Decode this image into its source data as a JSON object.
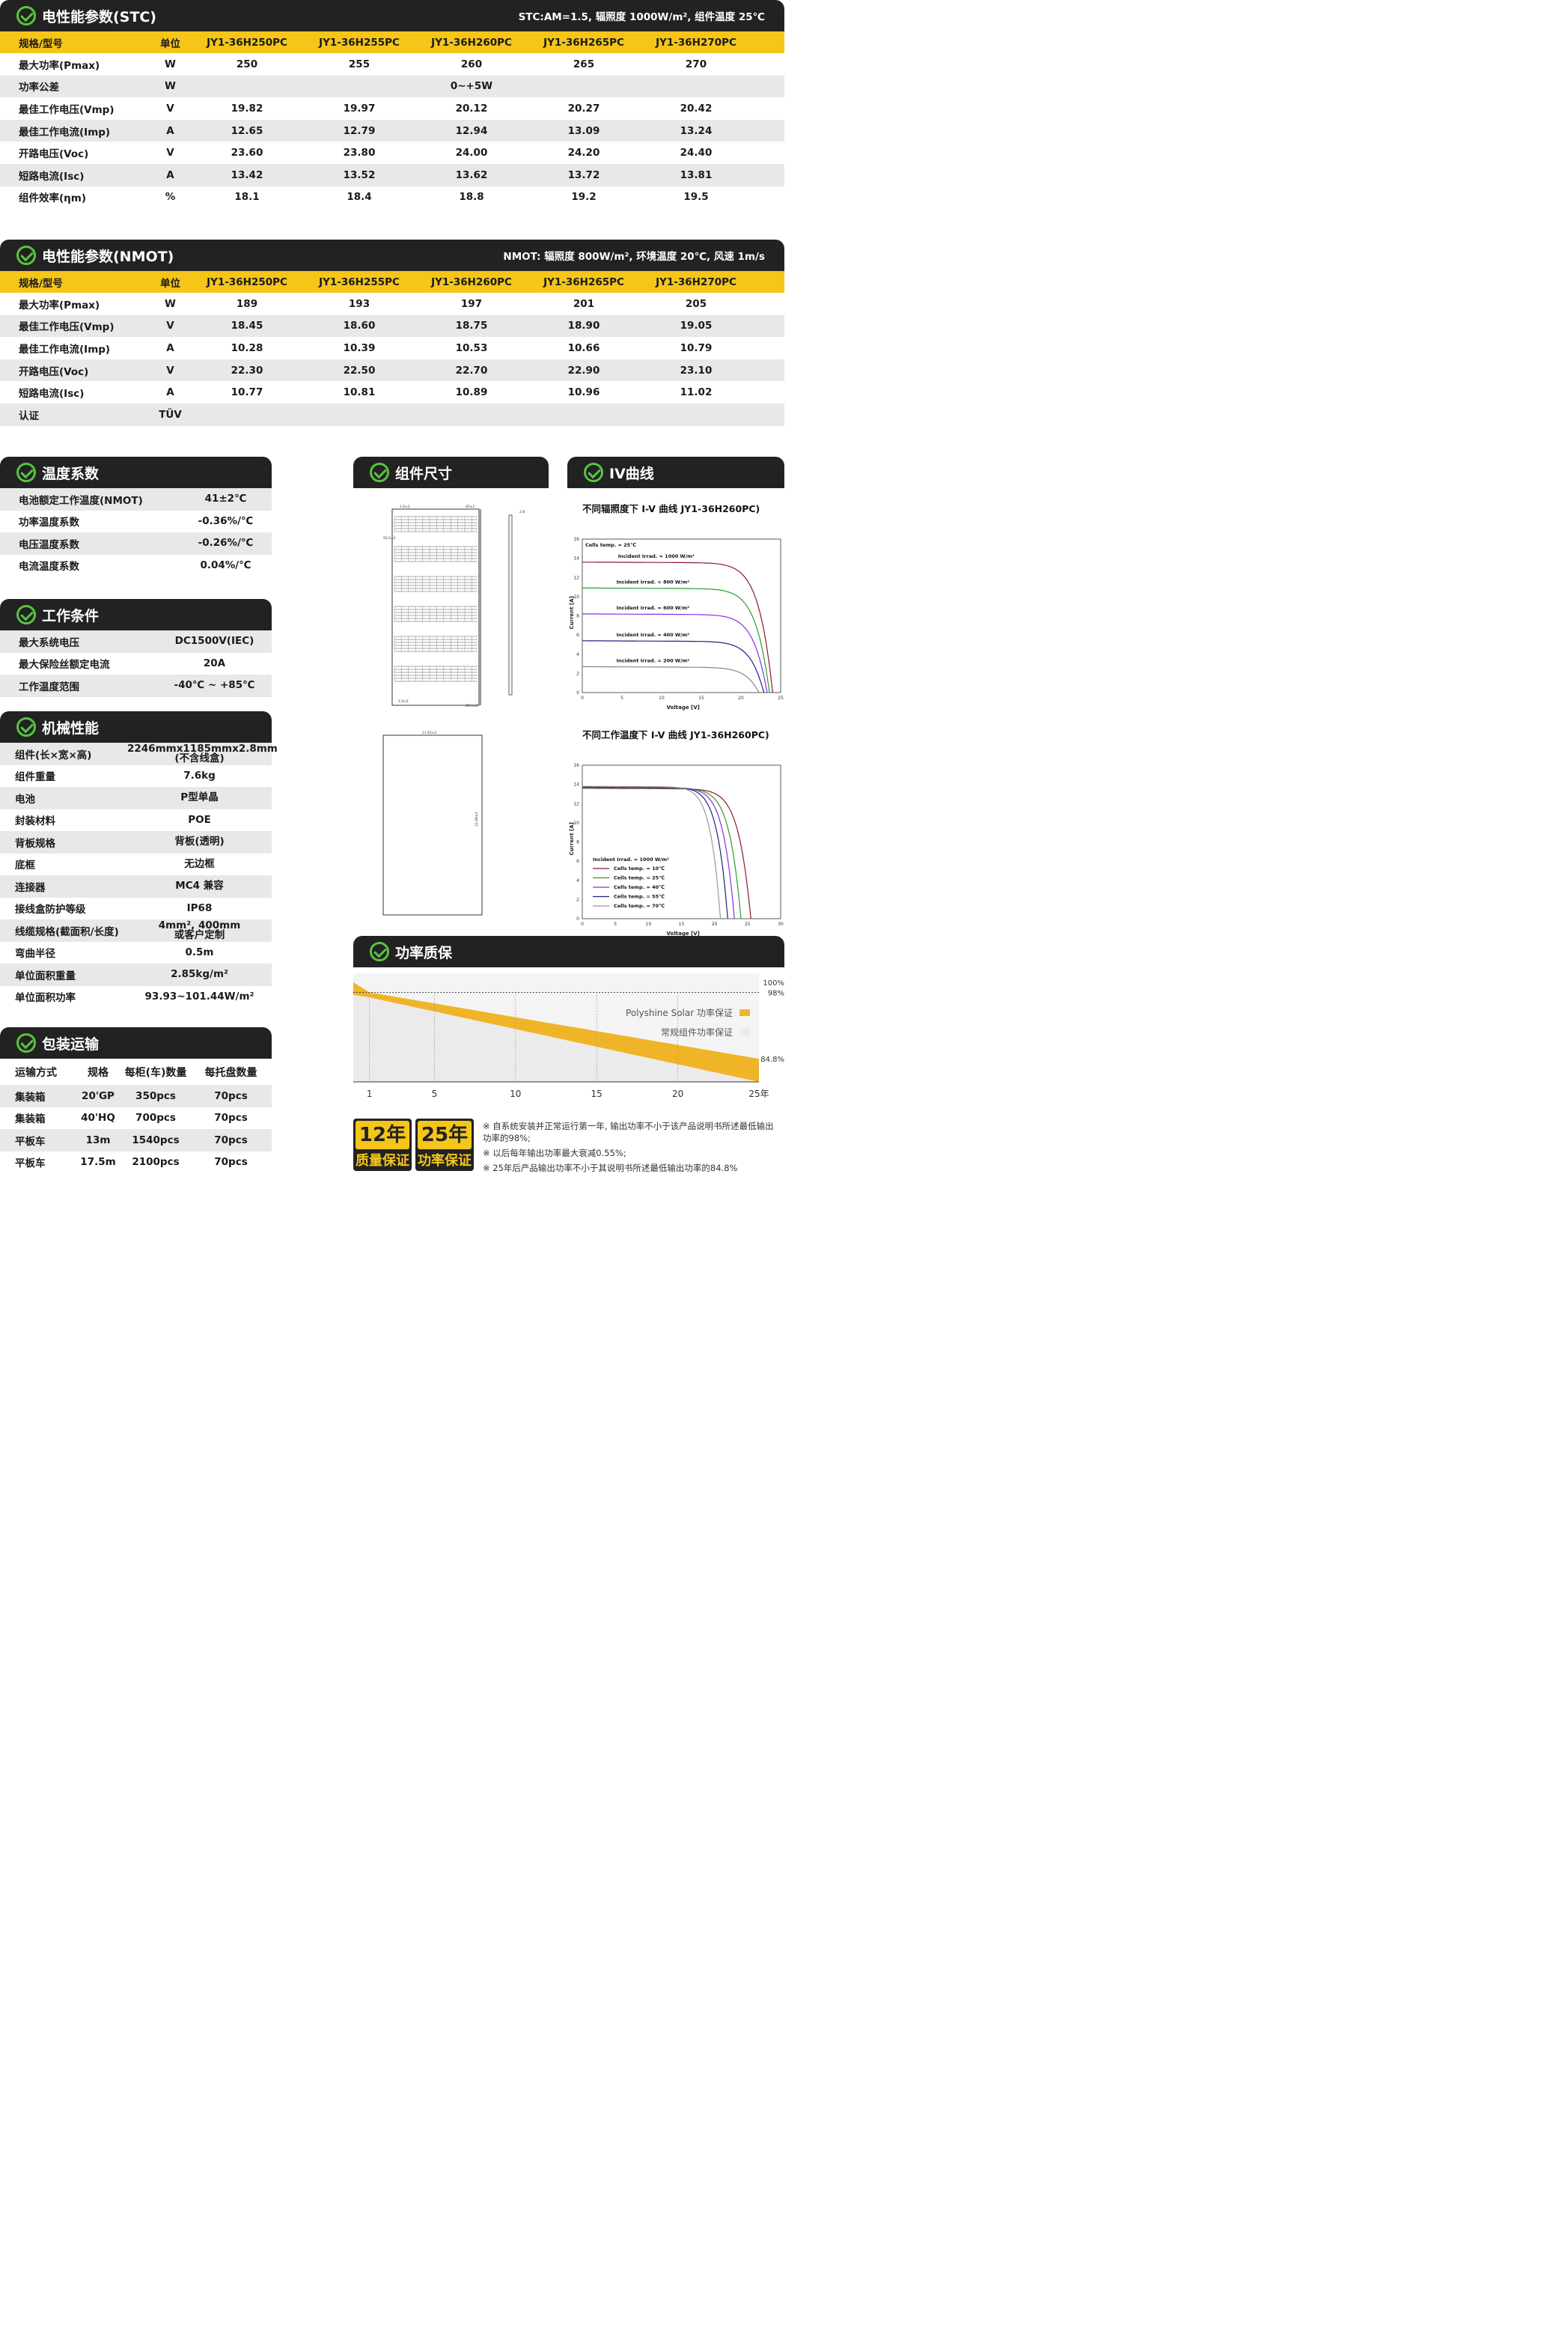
{
  "stc": {
    "title": "电性能参数(STC)",
    "note": "STC:AM=1.5, 辐照度 1000W/m², 组件温度 25℃",
    "header": [
      "规格/型号",
      "单位",
      "JY1-36H250PC",
      "JY1-36H255PC",
      "JY1-36H260PC",
      "JY1-36H265PC",
      "JY1-36H270PC"
    ],
    "rows": [
      [
        "最大功率(Pmax)",
        "W",
        "250",
        "255",
        "260",
        "265",
        "270"
      ],
      [
        "功率公差",
        "W",
        "",
        "",
        "0~+5W",
        "",
        ""
      ],
      [
        "最佳工作电压(Vmp)",
        "V",
        "19.82",
        "19.97",
        "20.12",
        "20.27",
        "20.42"
      ],
      [
        "最佳工作电流(Imp)",
        "A",
        "12.65",
        "12.79",
        "12.94",
        "13.09",
        "13.24"
      ],
      [
        "开路电压(Voc)",
        "V",
        "23.60",
        "23.80",
        "24.00",
        "24.20",
        "24.40"
      ],
      [
        "短路电流(Isc)",
        "A",
        "13.42",
        "13.52",
        "13.62",
        "13.72",
        "13.81"
      ],
      [
        "组件效率(ηm)",
        "%",
        "18.1",
        "18.4",
        "18.8",
        "19.2",
        "19.5"
      ]
    ]
  },
  "nmot": {
    "title": "电性能参数(NMOT)",
    "note": "NMOT: 辐照度 800W/m², 环境温度 20℃, 风速 1m/s",
    "header": [
      "规格/型号",
      "单位",
      "JY1-36H250PC",
      "JY1-36H255PC",
      "JY1-36H260PC",
      "JY1-36H265PC",
      "JY1-36H270PC"
    ],
    "rows": [
      [
        "最大功率(Pmax)",
        "W",
        "189",
        "193",
        "197",
        "201",
        "205"
      ],
      [
        "最佳工作电压(Vmp)",
        "V",
        "18.45",
        "18.60",
        "18.75",
        "18.90",
        "19.05"
      ],
      [
        "最佳工作电流(Imp)",
        "A",
        "10.28",
        "10.39",
        "10.53",
        "10.66",
        "10.79"
      ],
      [
        "开路电压(Voc)",
        "V",
        "22.30",
        "22.50",
        "22.70",
        "22.90",
        "23.10"
      ],
      [
        "短路电流(Isc)",
        "A",
        "10.77",
        "10.81",
        "10.89",
        "10.96",
        "11.02"
      ],
      [
        "认证",
        "TÜV",
        "",
        "",
        "",
        "",
        ""
      ]
    ]
  },
  "temp": {
    "title": "温度系数",
    "rows": [
      [
        "电池额定工作温度(NMOT)",
        "41±2℃"
      ],
      [
        "功率温度系数",
        "-0.36%/℃"
      ],
      [
        "电压温度系数",
        "-0.26%/℃"
      ],
      [
        "电流温度系数",
        "0.04%/℃"
      ]
    ]
  },
  "work": {
    "title": "工作条件",
    "rows": [
      [
        "最大系统电压",
        "DC1500V(IEC)"
      ],
      [
        "最大保险丝额定电流",
        "20A"
      ],
      [
        "工作温度范围",
        "-40℃ ~ +85℃"
      ]
    ]
  },
  "mech": {
    "title": "机械性能",
    "rows": [
      [
        "组件(长×宽×高)",
        "2246mmx1185mmx2.8mm\n(不含线盒)"
      ],
      [
        "组件重量",
        "7.6kg"
      ],
      [
        "电池",
        "P型单晶"
      ],
      [
        "封装材料",
        "POE"
      ],
      [
        "背板规格",
        "背板(透明)"
      ],
      [
        "底框",
        "无边框"
      ],
      [
        "连接器",
        "MC4 兼容"
      ],
      [
        "接线盒防护等级",
        "IP68"
      ],
      [
        "线缆规格(截面积/长度)",
        "4mm², 400mm\n或客户定制"
      ],
      [
        "弯曲半径",
        "0.5m"
      ],
      [
        "单位面积重量",
        "2.85kg/m²"
      ],
      [
        "单位面积功率",
        "93.93~101.44W/m²"
      ]
    ]
  },
  "pack": {
    "title": "包装运输",
    "header": [
      "运输方式",
      "规格",
      "每柜(车)数量",
      "每托盘数量"
    ],
    "rows": [
      [
        "集装箱",
        "20'GP",
        "350pcs",
        "70pcs"
      ],
      [
        "集装箱",
        "40'HQ",
        "700pcs",
        "70pcs"
      ],
      [
        "平板车",
        "13m",
        "1540pcs",
        "70pcs"
      ],
      [
        "平板车",
        "17.5m",
        "2100pcs",
        "70pcs"
      ]
    ]
  },
  "dim": {
    "title": "组件尺寸",
    "labels": [
      "1.6±2",
      "45±2",
      "2.8",
      "93.5±2",
      "1.6±2",
      "89.5±2",
      "11.65±2",
      "22.46±2"
    ]
  },
  "iv": {
    "title": "IV曲线"
  },
  "warranty": {
    "title": "功率质保",
    "badge1": {
      "years": "12年",
      "label": "质量保证"
    },
    "badge2": {
      "years": "25年",
      "label": "功率保证"
    },
    "notes": [
      "※ 自系统安装并正常运行第一年, 输出功率不小于该产品说明书所述最低输出功率的98%;",
      "※ 以后每年输出功率最大衰减0.55%;",
      "※ 25年后产品输出功率不小于其说明书所述最低输出功率的84.8%"
    ]
  },
  "chart_data": [
    {
      "type": "line",
      "title": "不同辐照度下 I-V 曲线  JY1-36H260PC)",
      "xlabel": "Voltage [V]",
      "ylabel": "Current [A]",
      "xlim": [
        0,
        25
      ],
      "ylim": [
        0,
        16
      ],
      "xticks": [
        "0",
        "5",
        "10",
        "15",
        "20",
        "25"
      ],
      "yticks": [
        "0",
        "2",
        "4",
        "6",
        "8",
        "10",
        "12",
        "14",
        "16"
      ],
      "annotation": "Cells temp. = 25℃",
      "series": [
        {
          "name": "Incident Irrad. = 1000 W/m²",
          "color": "#8b1a2b",
          "isc": 13.6,
          "voc": 24.0
        },
        {
          "name": "Incident Irrad. = 800 W/m²",
          "color": "#2a9d2a",
          "isc": 10.9,
          "voc": 23.6
        },
        {
          "name": "Incident Irrad. = 600 W/m²",
          "color": "#8a2be2",
          "isc": 8.2,
          "voc": 23.3
        },
        {
          "name": "Incident Irrad. = 400 W/m²",
          "color": "#1a237e",
          "isc": 5.4,
          "voc": 22.9
        },
        {
          "name": "Incident Irrad. = 200 W/m²",
          "color": "#888888",
          "isc": 2.7,
          "voc": 22.3
        }
      ]
    },
    {
      "type": "line",
      "title": "不同工作温度下 I-V 曲线  JY1-36H260PC)",
      "xlabel": "Voltage [V]",
      "ylabel": "Current [A]",
      "xlim": [
        0,
        30
      ],
      "ylim": [
        0,
        16
      ],
      "xticks": [
        "0",
        "5",
        "10",
        "15",
        "20",
        "25",
        "30"
      ],
      "yticks": [
        "0",
        "2",
        "4",
        "6",
        "8",
        "10",
        "12",
        "14",
        "16"
      ],
      "annotation": "Incident Irrad. = 1000 W/m²",
      "series": [
        {
          "name": "Cells temp. = 10℃",
          "color": "#8b1a2b",
          "isc": 13.6,
          "voc": 25.5
        },
        {
          "name": "Cells temp. = 25℃",
          "color": "#2a9d2a",
          "isc": 13.65,
          "voc": 24.0
        },
        {
          "name": "Cells temp. = 40℃",
          "color": "#8a2be2",
          "isc": 13.7,
          "voc": 23.0
        },
        {
          "name": "Cells temp. = 55℃",
          "color": "#1a237e",
          "isc": 13.75,
          "voc": 22.0
        },
        {
          "name": "Cells temp. = 70℃",
          "color": "#999999",
          "isc": 13.8,
          "voc": 20.9
        }
      ]
    },
    {
      "type": "area",
      "xlim": [
        0,
        25
      ],
      "ylim": [
        84.8,
        100
      ],
      "x_labels": [
        "1",
        "5",
        "10",
        "15",
        "20",
        "25年"
      ],
      "x_values": [
        1,
        5,
        10,
        15,
        20,
        25
      ],
      "y_labels": [
        "100%",
        "98%",
        "84.8%"
      ],
      "series": [
        {
          "name": "Polyshine Solar 功率保证",
          "color": "#f0b429",
          "points": [
            [
              0,
              100
            ],
            [
              1,
              98
            ],
            [
              25,
              84.8
            ]
          ]
        },
        {
          "name": "常规组件功率保证",
          "color": "#ebebeb",
          "points": [
            [
              0,
              97.5
            ],
            [
              1,
              97.0
            ],
            [
              25,
              80.2
            ]
          ]
        }
      ]
    }
  ]
}
